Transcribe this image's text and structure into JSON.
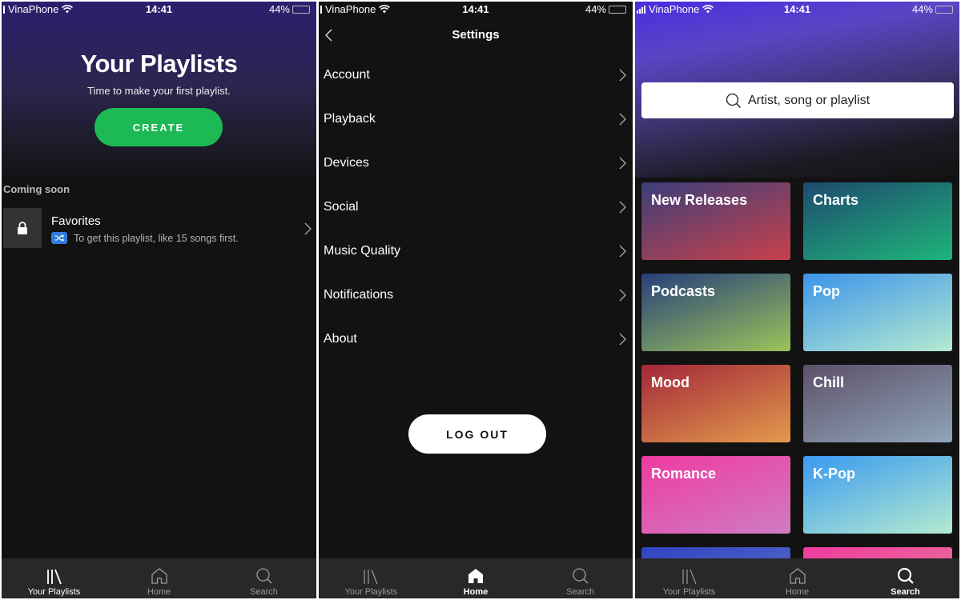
{
  "status_bar": {
    "carrier": "VinaPhone",
    "time": "14:41",
    "battery_percent_label": "44%",
    "battery_level": 0.44
  },
  "screen_playlists": {
    "title": "Your Playlists",
    "subtitle": "Time to make your first playlist.",
    "create_label": "CREATE",
    "section_label": "Coming soon",
    "favorites": {
      "name": "Favorites",
      "hint": "To get this playlist, like 15 songs first.",
      "thumb_icon": "lock-icon",
      "badge_icon": "shuffle-icon"
    }
  },
  "screen_settings": {
    "title": "Settings",
    "items": [
      {
        "label": "Account"
      },
      {
        "label": "Playback"
      },
      {
        "label": "Devices"
      },
      {
        "label": "Social"
      },
      {
        "label": "Music Quality"
      },
      {
        "label": "Notifications"
      },
      {
        "label": "About"
      }
    ],
    "logout_label": "LOG OUT"
  },
  "screen_search": {
    "search_placeholder": "Artist, song or playlist",
    "categories": [
      {
        "label": "New Releases",
        "colors": [
          "#3c3f7a",
          "#c9404a"
        ]
      },
      {
        "label": "Charts",
        "colors": [
          "#1f4a6e",
          "#1db57a"
        ]
      },
      {
        "label": "Podcasts",
        "colors": [
          "#27407a",
          "#9cc35a"
        ]
      },
      {
        "label": "Pop",
        "colors": [
          "#3d94ea",
          "#b4ead0"
        ]
      },
      {
        "label": "Mood",
        "colors": [
          "#a3283a",
          "#e39a4c"
        ]
      },
      {
        "label": "Chill",
        "colors": [
          "#5d5069",
          "#8fa5b8"
        ]
      },
      {
        "label": "Romance",
        "colors": [
          "#ef3aa0",
          "#cf7cc3"
        ]
      },
      {
        "label": "K-Pop",
        "colors": [
          "#3a9af0",
          "#b3ead0"
        ]
      },
      {
        "label": "",
        "colors": [
          "#3143c0",
          "#4f62c8"
        ]
      },
      {
        "label": "",
        "colors": [
          "#ee3a9e",
          "#ec6a9a"
        ]
      }
    ]
  },
  "tabbar": {
    "tabs": [
      {
        "label": "Your Playlists",
        "icon": "library-icon"
      },
      {
        "label": "Home",
        "icon": "home-icon"
      },
      {
        "label": "Search",
        "icon": "search-icon"
      }
    ],
    "active_per_screen": [
      "Your Playlists",
      "Home",
      "Search"
    ]
  },
  "colors": {
    "spotify_green": "#1db954",
    "background": "#121212",
    "tabbar": "#282828"
  }
}
